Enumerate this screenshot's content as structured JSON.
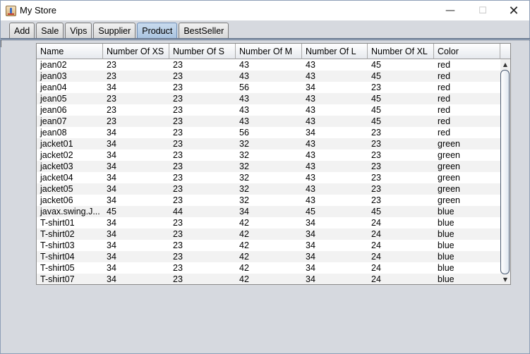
{
  "window": {
    "title": "My Store"
  },
  "title_controls": {
    "minimize": "—",
    "maximize": "☐",
    "close": "✕"
  },
  "tabs": [
    {
      "label": "Add"
    },
    {
      "label": "Sale"
    },
    {
      "label": "Vips"
    },
    {
      "label": "Supplier"
    },
    {
      "label": "Product",
      "active": true
    },
    {
      "label": "BestSeller"
    }
  ],
  "table": {
    "columns": [
      "Name",
      "Number Of XS",
      "Number Of S",
      "Number Of M",
      "Number Of L",
      "Number Of XL",
      "Color"
    ],
    "rows": [
      [
        "jean02",
        "23",
        "23",
        "43",
        "43",
        "45",
        "red"
      ],
      [
        "jean03",
        "23",
        "23",
        "43",
        "43",
        "45",
        "red"
      ],
      [
        "jean04",
        "34",
        "23",
        "56",
        "34",
        "23",
        "red"
      ],
      [
        "jean05",
        "23",
        "23",
        "43",
        "43",
        "45",
        "red"
      ],
      [
        "jean06",
        "23",
        "23",
        "43",
        "43",
        "45",
        "red"
      ],
      [
        "jean07",
        "23",
        "23",
        "43",
        "43",
        "45",
        "red"
      ],
      [
        "jean08",
        "34",
        "23",
        "56",
        "34",
        "23",
        "red"
      ],
      [
        "jacket01",
        "34",
        "23",
        "32",
        "43",
        "23",
        "green"
      ],
      [
        "jacket02",
        "34",
        "23",
        "32",
        "43",
        "23",
        "green"
      ],
      [
        "jacket03",
        "34",
        "23",
        "32",
        "43",
        "23",
        "green"
      ],
      [
        "jacket04",
        "34",
        "23",
        "32",
        "43",
        "23",
        "green"
      ],
      [
        "jacket05",
        "34",
        "23",
        "32",
        "43",
        "23",
        "green"
      ],
      [
        "jacket06",
        "34",
        "23",
        "32",
        "43",
        "23",
        "green"
      ],
      [
        "javax.swing.J...",
        "45",
        "44",
        "34",
        "45",
        "45",
        "blue"
      ],
      [
        "T-shirt01",
        "34",
        "23",
        "42",
        "34",
        "24",
        "blue"
      ],
      [
        "T-shirt02",
        "34",
        "23",
        "42",
        "34",
        "24",
        "blue"
      ],
      [
        "T-shirt03",
        "34",
        "23",
        "42",
        "34",
        "24",
        "blue"
      ],
      [
        "T-shirt04",
        "34",
        "23",
        "42",
        "34",
        "24",
        "blue"
      ],
      [
        "T-shirt05",
        "34",
        "23",
        "42",
        "34",
        "24",
        "blue"
      ],
      [
        "T-shirt07",
        "34",
        "23",
        "42",
        "34",
        "24",
        "blue"
      ]
    ]
  },
  "scrollbar": {
    "up_arrow": "▲",
    "down_arrow": "▼"
  },
  "colors": {
    "active_tab": "#a9c3e0",
    "alt_row": "#f2f2f2",
    "background": "#d6d9df"
  }
}
